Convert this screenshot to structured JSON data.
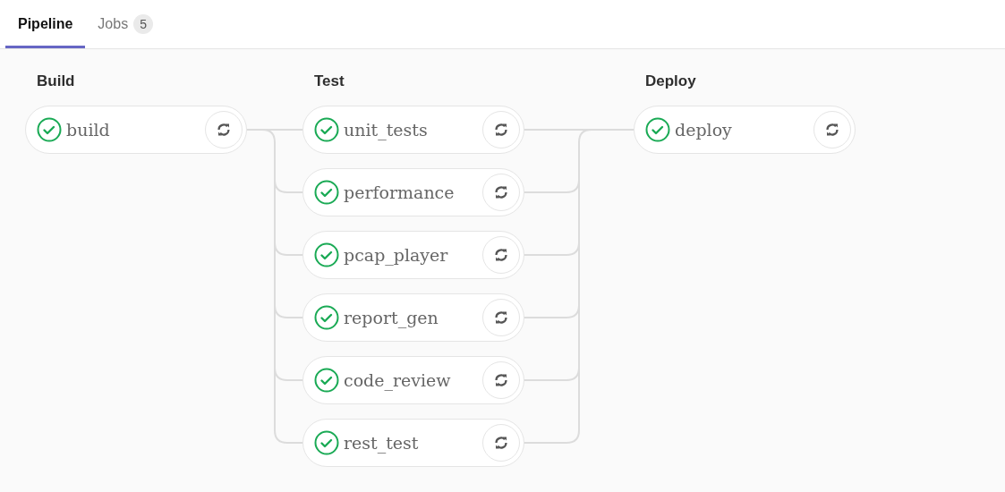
{
  "tabs": [
    {
      "label": "Pipeline",
      "selected": true
    },
    {
      "label": "Jobs",
      "count": "5",
      "selected": false
    }
  ],
  "stages": [
    {
      "title": "Build",
      "jobs": [
        {
          "name": "build",
          "passed": true
        }
      ]
    },
    {
      "title": "Test",
      "jobs": [
        {
          "name": "unit_tests",
          "passed": true
        },
        {
          "name": "performance",
          "passed": true
        },
        {
          "name": "pcap_player",
          "passed": true
        },
        {
          "name": "report_gen",
          "passed": true
        },
        {
          "name": "code_review",
          "passed": true
        },
        {
          "name": "rest_test",
          "passed": true
        }
      ]
    },
    {
      "title": "Deploy",
      "jobs": [
        {
          "name": "deploy",
          "passed": true
        }
      ]
    }
  ]
}
